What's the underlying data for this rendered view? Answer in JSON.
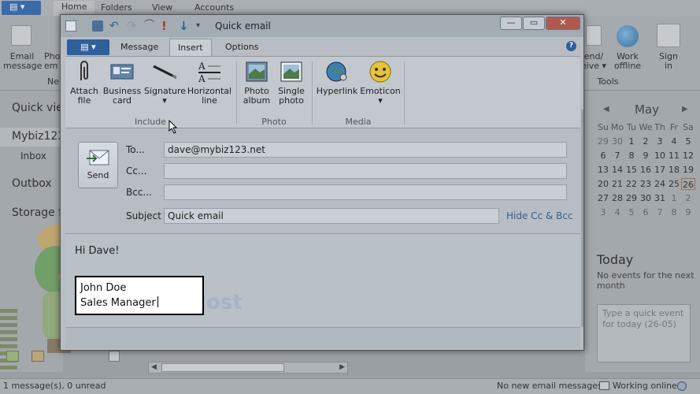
{
  "background_app": {
    "tabs": [
      "Home",
      "Folders",
      "View",
      "Accounts"
    ],
    "ribbon_left": [
      {
        "label": "Email\nmessage"
      },
      {
        "label": "Pho\nem"
      }
    ],
    "ribbon_left_group": "Ne",
    "ribbon_right": [
      {
        "label": "end/\neive ▾"
      },
      {
        "label": "Work\noffline"
      },
      {
        "label": "Sign\nin"
      }
    ],
    "ribbon_right_group": "Tools",
    "left_pane": {
      "quick_views": "Quick vie",
      "account": "Mybiz123",
      "inbox": "Inbox",
      "outbox": "Outbox",
      "storage": "Storage f"
    },
    "calendar": {
      "month": "May",
      "prev": "◀",
      "next": "▶",
      "weekdays": [
        "Su",
        "Mo",
        "Tu",
        "We",
        "Th",
        "Fr",
        "Sa"
      ],
      "weeks": [
        [
          "29",
          "30",
          "1",
          "2",
          "3",
          "4",
          "5"
        ],
        [
          "6",
          "7",
          "8",
          "9",
          "10",
          "11",
          "12"
        ],
        [
          "13",
          "14",
          "15",
          "16",
          "17",
          "18",
          "19"
        ],
        [
          "20",
          "21",
          "22",
          "23",
          "24",
          "25",
          "26"
        ],
        [
          "27",
          "28",
          "29",
          "30",
          "31",
          "1",
          "2"
        ],
        [
          "3",
          "4",
          "5",
          "6",
          "7",
          "8",
          "9"
        ]
      ],
      "today_day": "26"
    },
    "today_heading": "Today",
    "today_text": "No events for the next month",
    "quick_event_placeholder": "Type a quick event for today (26-05)",
    "status_left": "1 message(s), 0 unread",
    "status_mid": "No new email messages",
    "status_right": "Working online"
  },
  "compose_window": {
    "title": "Quick email",
    "controls": {
      "minimize": "—",
      "maximize": "▭",
      "close": "✕"
    },
    "file_tab": "▤ ▾",
    "tabs": [
      {
        "label": "Message",
        "active": false
      },
      {
        "label": "Insert",
        "active": true
      },
      {
        "label": "Options",
        "active": false
      }
    ],
    "help": "?",
    "ribbon": {
      "include_group": "Include",
      "photo_group": "Photo",
      "media_group": "Media",
      "buttons": {
        "attach": "Attach\nfile",
        "business": "Business\ncard",
        "signature": "Signature\n▾",
        "hline": "Horizontal\nline",
        "photo_album": "Photo\nalbum",
        "single_photo": "Single\nphoto",
        "hyperlink": "Hyperlink",
        "emoticon": "Emoticon\n▾"
      }
    },
    "send_label": "Send",
    "fields": {
      "to_label": "To...",
      "to_value": "dave@mybiz123.net",
      "cc_label": "Cc...",
      "cc_value": "",
      "bcc_label": "Bcc...",
      "bcc_value": "",
      "subject_label": "Subject",
      "subject_value": "Quick email",
      "hide_link": "Hide Cc & Bcc"
    },
    "body": {
      "greeting": "Hi Dave!",
      "signature_line1": "John Doe",
      "signature_line2": "Sales Manager"
    }
  }
}
